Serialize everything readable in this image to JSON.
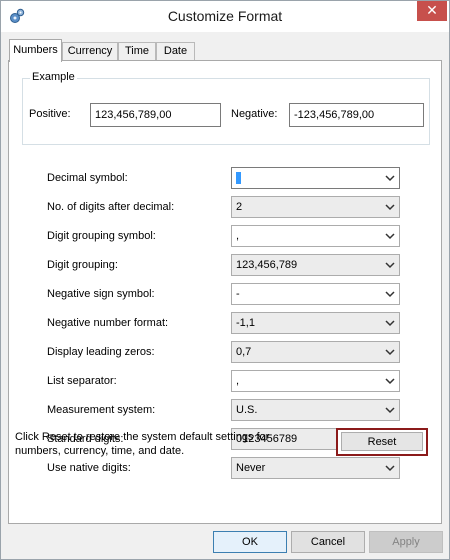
{
  "window": {
    "title": "Customize Format",
    "close_label": "✕"
  },
  "tabs": [
    {
      "label": "Numbers",
      "active": true
    },
    {
      "label": "Currency",
      "active": false
    },
    {
      "label": "Time",
      "active": false
    },
    {
      "label": "Date",
      "active": false
    }
  ],
  "example": {
    "group_label": "Example",
    "positive_label": "Positive:",
    "positive_value": "123,456,789,00",
    "negative_label": "Negative:",
    "negative_value": "-123,456,789,00"
  },
  "settings": [
    {
      "label": "Decimal symbol:",
      "value": "",
      "editable": true,
      "focused": true
    },
    {
      "label": "No. of digits after decimal:",
      "value": "2",
      "editable": false
    },
    {
      "label": "Digit grouping symbol:",
      "value": ",",
      "editable": true
    },
    {
      "label": "Digit grouping:",
      "value": "123,456,789",
      "editable": false
    },
    {
      "label": "Negative sign symbol:",
      "value": "-",
      "editable": true
    },
    {
      "label": "Negative number format:",
      "value": "-1,1",
      "editable": false
    },
    {
      "label": "Display leading zeros:",
      "value": "0,7",
      "editable": false
    },
    {
      "label": "List separator:",
      "value": ",",
      "editable": true
    },
    {
      "label": "Measurement system:",
      "value": "U.S.",
      "editable": false
    },
    {
      "label": "Standard digits:",
      "value": "0123456789",
      "editable": false
    },
    {
      "label": "Use native digits:",
      "value": "Never",
      "editable": false
    }
  ],
  "reset": {
    "note": "Click Reset to restore the system default settings for numbers, currency, time, and date.",
    "button_label": "Reset"
  },
  "buttons": {
    "ok": "OK",
    "cancel": "Cancel",
    "apply": "Apply"
  },
  "colors": {
    "close": "#c7504c",
    "reset_highlight": "#8b1a1a",
    "focus": "#3399ff"
  }
}
